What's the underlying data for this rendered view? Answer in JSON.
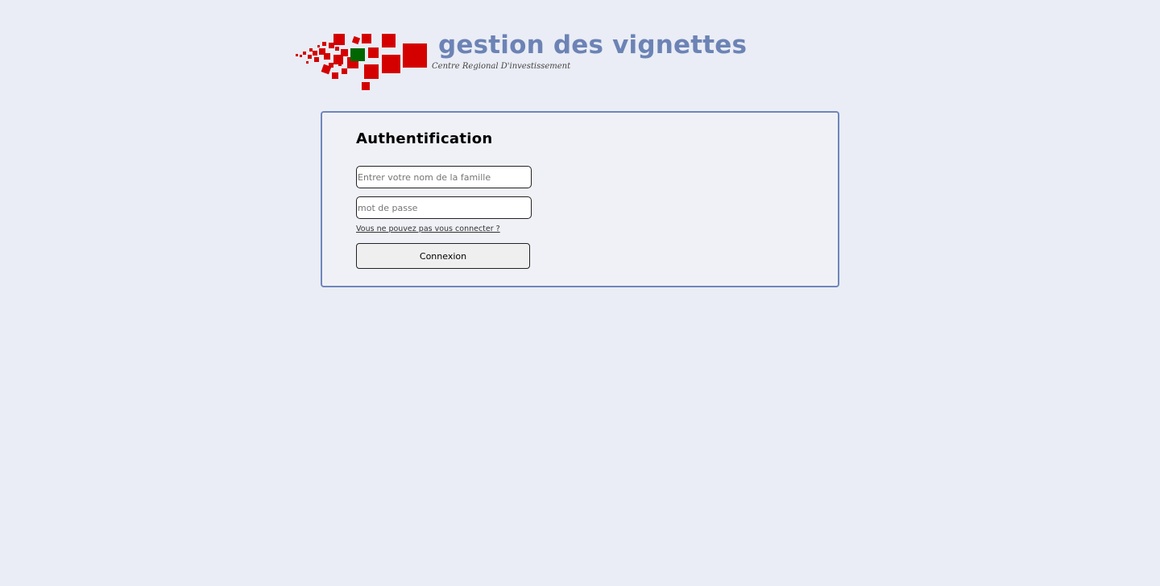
{
  "header": {
    "title": "gestion des vignettes",
    "subtitle": "Centre Regional D'investissement",
    "logo_icon": "red-squares-logo-icon",
    "title_color": "#6c83b5"
  },
  "login": {
    "heading": "Authentification",
    "username_placeholder": "Entrer votre nom de la famille",
    "username_value": "",
    "password_placeholder": "mot de passe",
    "password_value": "",
    "help_link": "Vous ne pouvez pas vous connecter ?",
    "submit_label": "Connexion",
    "border_color": "#6f86bd"
  },
  "colors": {
    "background": "#eaedf5",
    "logo_red": "#d40000",
    "logo_green": "#006600"
  }
}
